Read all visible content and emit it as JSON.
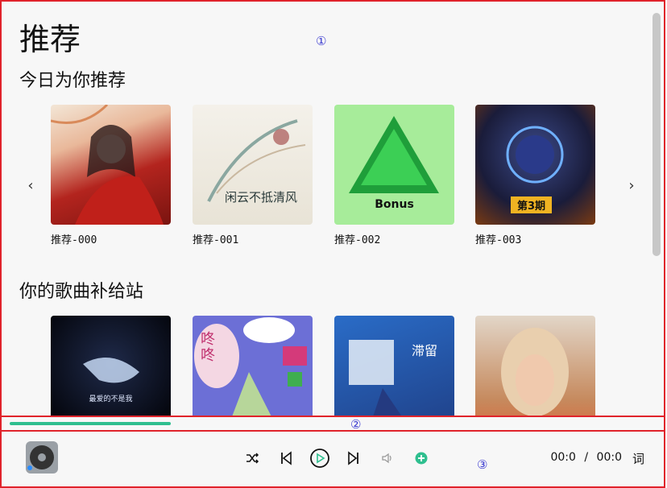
{
  "markers": [
    "①",
    "②",
    "③"
  ],
  "page_title": "推荐",
  "sections": [
    {
      "title": "今日为你推荐",
      "cards": [
        {
          "label": "推荐-000",
          "cover_text": ""
        },
        {
          "label": "推荐-001",
          "cover_text": "闲云不抵清风"
        },
        {
          "label": "推荐-002",
          "cover_text": "Bonus"
        },
        {
          "label": "推荐-003",
          "cover_text": "第3期"
        }
      ]
    },
    {
      "title": "你的歌曲补给站",
      "cards": [
        {
          "label": "",
          "cover_text": "最爱的不是我"
        },
        {
          "label": "",
          "cover_text": "咚咚"
        },
        {
          "label": "",
          "cover_text": "滞留"
        },
        {
          "label": "",
          "cover_text": ""
        }
      ]
    }
  ],
  "nav": {
    "prev_icon": "chevron-left-icon",
    "next_icon": "chevron-right-icon",
    "prev_glyph": "‹",
    "next_glyph": "›"
  },
  "player": {
    "progress": 0.25,
    "current_time": "00:0",
    "separator": "/",
    "total_time": "00:0",
    "lyric_label": "词",
    "controls": [
      "shuffle-icon",
      "previous-icon",
      "play-icon",
      "next-icon",
      "volume-icon",
      "add-icon"
    ],
    "accent_color": "#2fbf8f"
  }
}
